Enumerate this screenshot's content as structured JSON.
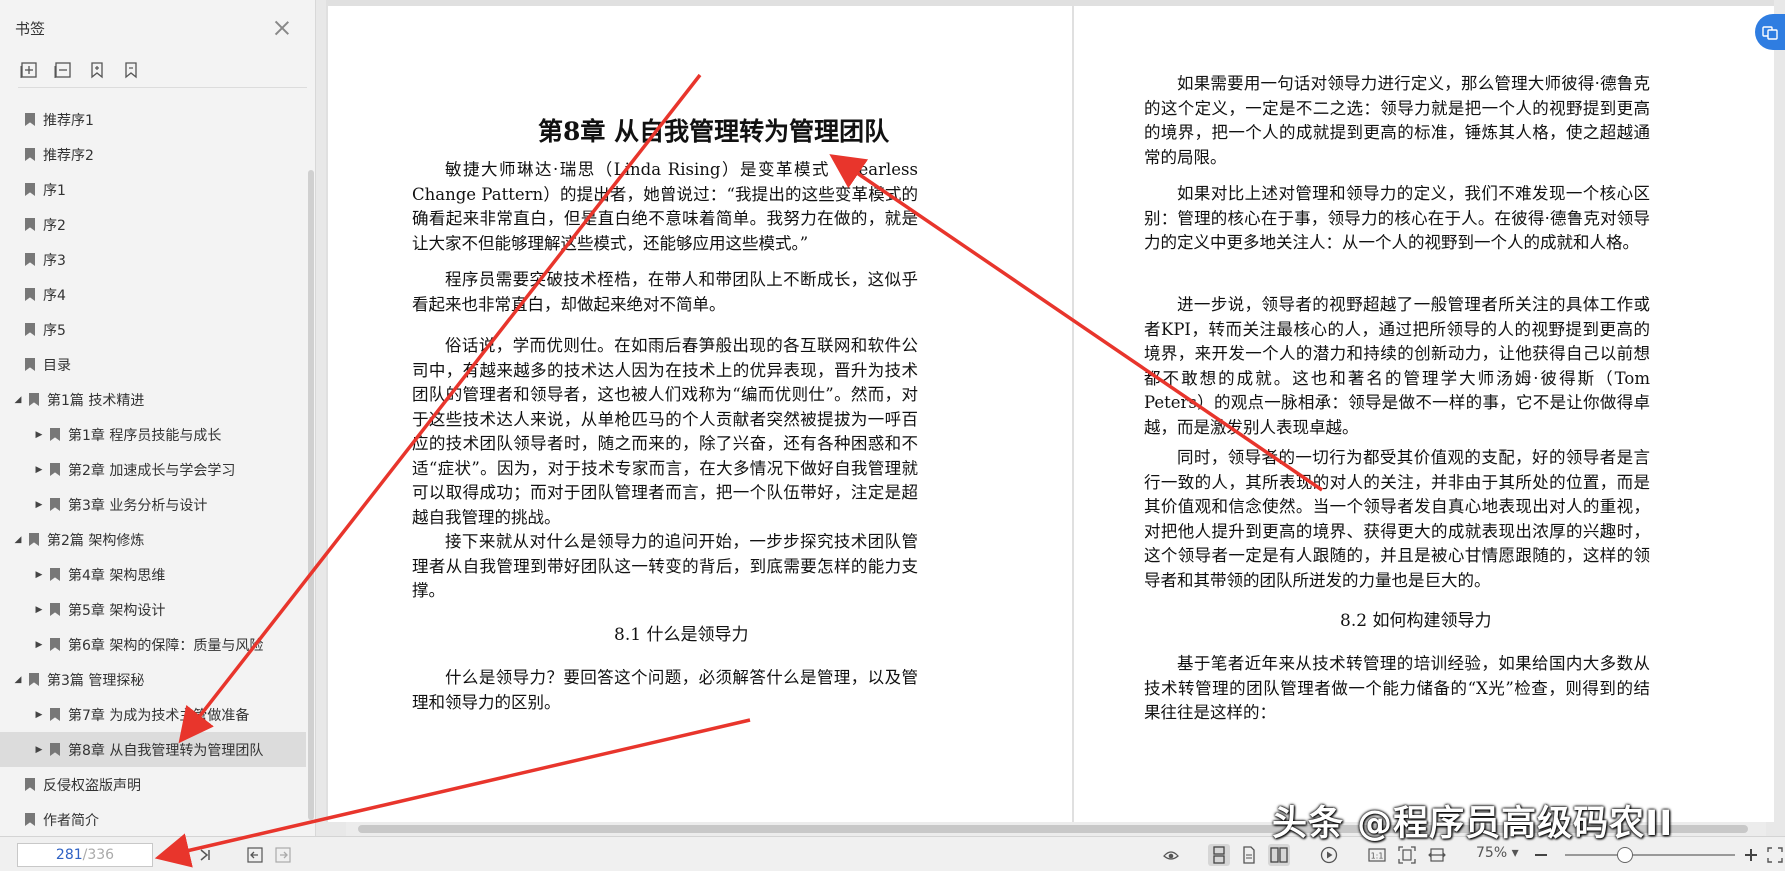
{
  "sidebar": {
    "title": "书签",
    "items": [
      {
        "label": "推荐序1",
        "level": 0
      },
      {
        "label": "推荐序2",
        "level": 0
      },
      {
        "label": "序1",
        "level": 0
      },
      {
        "label": "序2",
        "level": 0
      },
      {
        "label": "序3",
        "level": 0
      },
      {
        "label": "序4",
        "level": 0
      },
      {
        "label": "序5",
        "level": 0
      },
      {
        "label": "目录",
        "level": 0
      },
      {
        "label": "第1篇 技术精进",
        "level": 0,
        "expanded": true
      },
      {
        "label": "第1章 程序员技能与成长",
        "level": 1
      },
      {
        "label": "第2章 加速成长与学会学习",
        "level": 1
      },
      {
        "label": "第3章 业务分析与设计",
        "level": 1
      },
      {
        "label": "第2篇 架构修炼",
        "level": 0,
        "expanded": true
      },
      {
        "label": "第4章 架构思维",
        "level": 1
      },
      {
        "label": "第5章 架构设计",
        "level": 1
      },
      {
        "label": "第6章 架构的保障：质量与风险",
        "level": 1
      },
      {
        "label": "第3篇 管理探秘",
        "level": 0,
        "expanded": true
      },
      {
        "label": "第7章 为成为技术主管做准备",
        "level": 1
      },
      {
        "label": "第8章 从自我管理转为管理团队",
        "level": 1,
        "selected": true
      },
      {
        "label": "反侵权盗版声明",
        "level": 0
      },
      {
        "label": "作者简介",
        "level": 0
      }
    ]
  },
  "left_page": {
    "chapter_title": "第8章  从自我管理转为管理团队",
    "paragraphs": [
      "敏捷大师琳达·瑞思（Linda Rising）是变革模式（Fearless Change Pattern）的提出者，她曾说过：“我提出的这些变革模式的确看起来非常直白，但是直白绝不意味着简单。我努力在做的，就是让大家不但能够理解这些模式，还能够应用这些模式。”",
      "程序员需要突破技术桎梏，在带人和带团队上不断成长，这似乎看起来也非常直白，却做起来绝对不简单。",
      "俗话说，学而优则仕。在如雨后春笋般出现的各互联网和软件公司中，有越来越多的技术达人因为在技术上的优异表现，晋升为技术团队的管理者和领导者，这也被人们戏称为“编而优则仕”。然而，对于这些技术达人来说，从单枪匹马的个人贡献者突然被提拔为一呼百应的技术团队领导者时，随之而来的，除了兴奋，还有各种困惑和不适“症状”。因为，对于技术专家而言，在大多情况下做好自我管理就可以取得成功；而对于团队管理者而言，把一个队伍带好，注定是超越自我管理的挑战。",
      "接下来就从对什么是领导力的追问开始，一步步探究技术团队管理者从自我管理到带好团队这一转变的背后，到底需要怎样的能力支撑。"
    ],
    "section_title": "8.1  什么是领导力",
    "last_paragraph": "什么是领导力？要回答这个问题，必须解答什么是管理，以及管理和领导力的区别。"
  },
  "right_page": {
    "paragraphs": [
      "如果需要用一句话对领导力进行定义，那么管理大师彼得·德鲁克的这个定义，一定是不二之选：领导力就是把一个人的视野提到更高的境界，把一个人的成就提到更高的标准，锤炼其人格，使之超越通常的局限。",
      "如果对比上述对管理和领导力的定义，我们不难发现一个核心区别：管理的核心在于事，领导力的核心在于人。在彼得·德鲁克对领导力的定义中更多地关注人：从一个人的视野到一个人的成就和人格。",
      "进一步说，领导者的视野超越了一般管理者所关注的具体工作或者KPI，转而关注最核心的人，通过把所领导的人的视野提到更高的境界，来开发一个人的潜力和持续的创新动力，让他获得自己以前想都不敢想的成就。这也和著名的管理学大师汤姆·彼得斯（Tom Peters）的观点一脉相承：领导是做不一样的事，它不是让你做得卓越，而是激发别人表现卓越。",
      "同时，领导者的一切行为都受其价值观的支配，好的领导者是言行一致的人，其所表现的对人的关注，并非由于其所处的位置，而是其价值观和信念使然。当一个领导者发自真心地表现出对人的重视，对把他人提升到更高的境界、获得更大的成就表现出浓厚的兴趣时，这个领导者一定是有人跟随的，并且是被心甘情愿跟随的，这样的领导者和其带领的团队所迸发的力量也是巨大的。"
    ],
    "section_title": "8.2  如何构建领导力",
    "last_paragraph": "基于笔者近年来从技术转管理的培训经验，如果给国内大多数从技术转管理的团队管理者做一个能力储备的“X光”检查，则得到的结果往往是这样的："
  },
  "statusbar": {
    "current_page": "281",
    "total_pages": "/336",
    "zoom": "75%",
    "zoom_level_percent": 75
  },
  "watermark": "头条 @程序员高级码农II",
  "colors": {
    "accent": "#2f7de1",
    "arrow": "#e8352c",
    "page_number": "#2f62c4"
  }
}
